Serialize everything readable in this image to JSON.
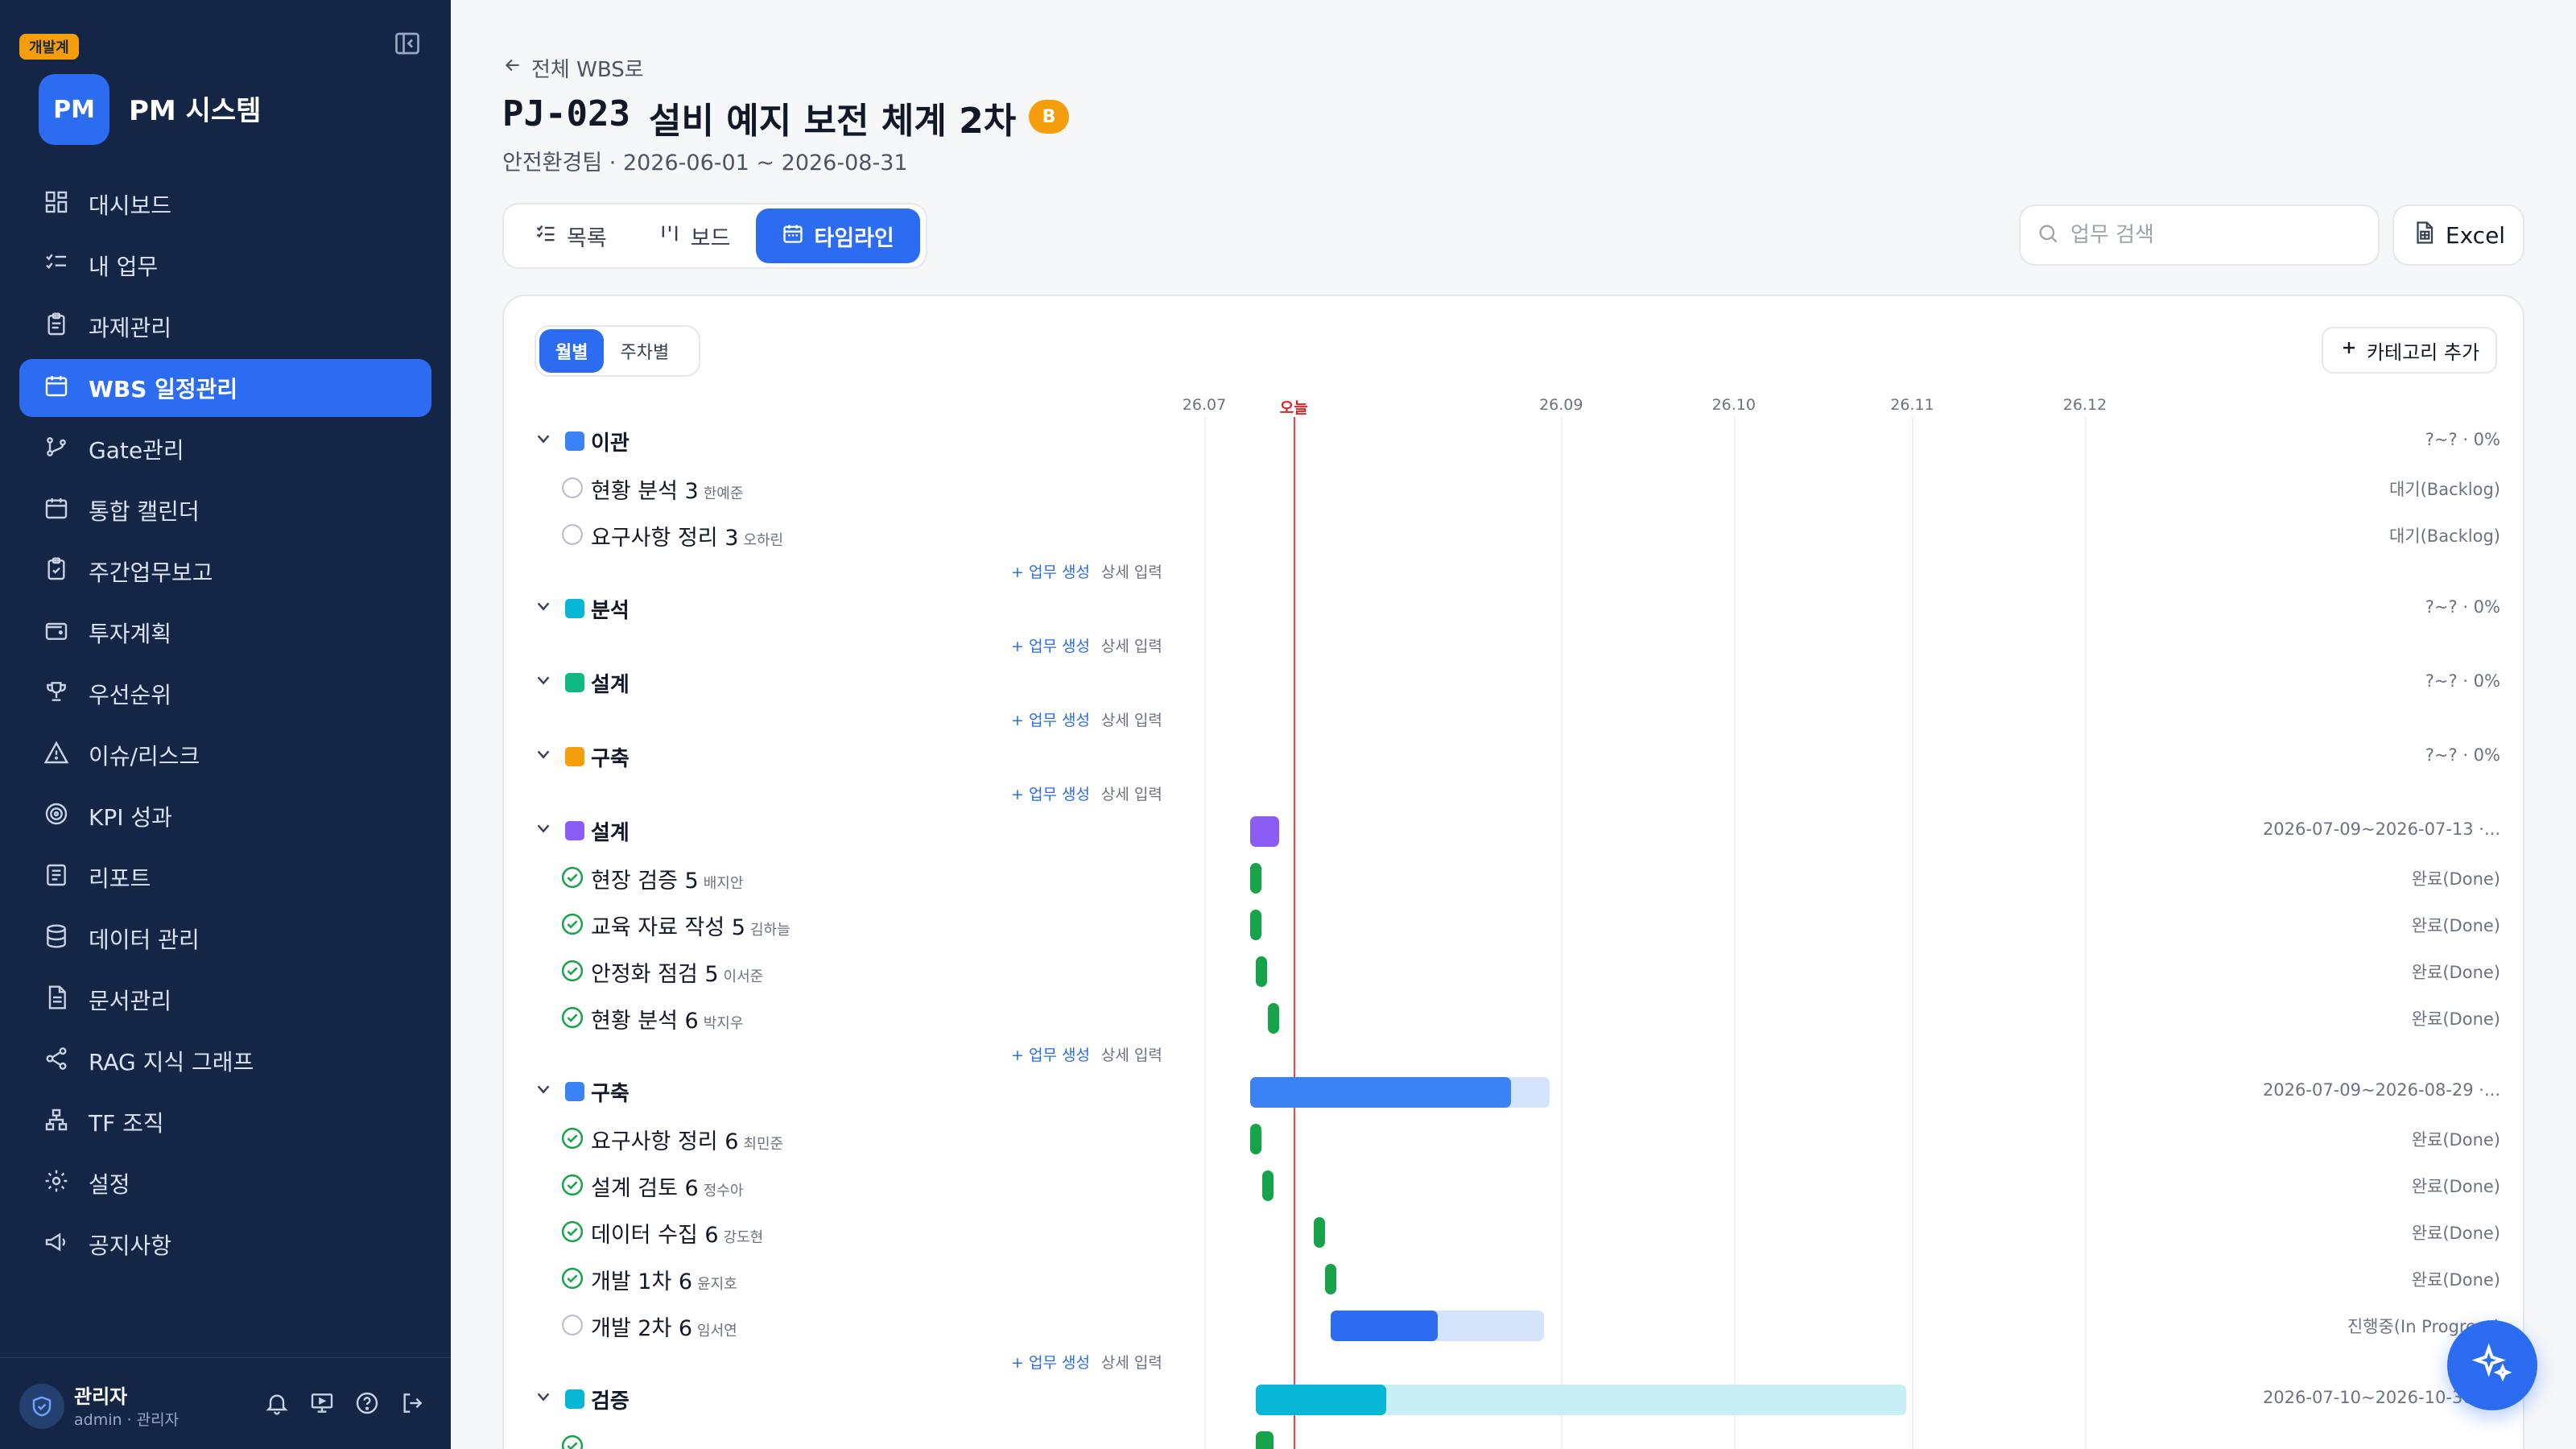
{
  "sidebar": {
    "env_badge": "개발계",
    "logo": "PM",
    "app_name": "PM 시스템",
    "items": [
      {
        "label": "대시보드",
        "icon": "dashboard-icon"
      },
      {
        "label": "내 업무",
        "icon": "checklist-icon"
      },
      {
        "label": "과제관리",
        "icon": "clipboard-icon"
      },
      {
        "label": "WBS 일정관리",
        "icon": "calendar-icon",
        "active": true
      },
      {
        "label": "Gate관리",
        "icon": "git-branch-icon"
      },
      {
        "label": "통합 캘린더",
        "icon": "calendar-icon"
      },
      {
        "label": "주간업무보고",
        "icon": "clipboard-check-icon"
      },
      {
        "label": "투자계획",
        "icon": "wallet-icon"
      },
      {
        "label": "우선순위",
        "icon": "trophy-icon"
      },
      {
        "label": "이슈/리스크",
        "icon": "warning-icon"
      },
      {
        "label": "KPI 성과",
        "icon": "target-icon"
      },
      {
        "label": "리포트",
        "icon": "report-icon"
      },
      {
        "label": "데이터 관리",
        "icon": "database-icon"
      },
      {
        "label": "문서관리",
        "icon": "document-icon"
      },
      {
        "label": "RAG 지식 그래프",
        "icon": "share-icon"
      },
      {
        "label": "TF 조직",
        "icon": "org-chart-icon"
      },
      {
        "label": "설정",
        "icon": "gear-icon"
      },
      {
        "label": "공지사항",
        "icon": "megaphone-icon"
      }
    ],
    "user": {
      "name": "관리자",
      "sub": "admin · 관리자"
    }
  },
  "header": {
    "back_label": "전체 WBS로",
    "project_code": "PJ-023",
    "project_name": "설비 예지 보전 체계 2차",
    "grade": "B",
    "subtitle": "안전환경팀 · 2026-06-01 ~ 2026-08-31"
  },
  "view_tabs": [
    {
      "label": "목록",
      "icon": "list-check-icon"
    },
    {
      "label": "보드",
      "icon": "kanban-icon"
    },
    {
      "label": "타임라인",
      "icon": "calendar-icon",
      "active": true
    }
  ],
  "search": {
    "placeholder": "업무 검색",
    "value": ""
  },
  "excel_label": "Excel",
  "scale_tabs": [
    {
      "label": "월별",
      "active": true
    },
    {
      "label": "주차별"
    }
  ],
  "add_category_label": "카테고리 추가",
  "row_actions": {
    "create": "+ 업무 생성",
    "detail": "상세 입력"
  },
  "timeline": {
    "labels": [
      "26.07",
      "오늘",
      "26.09",
      "26.10",
      "26.11",
      "26.12"
    ],
    "today_label": "오늘"
  },
  "colors": {
    "accent": "#2b6cf0",
    "done": "#16a34a",
    "today": "#ef4444"
  },
  "rows": [
    {
      "type": "category",
      "name": "이관",
      "color": "#3b82f6",
      "info": "?~? · 0%"
    },
    {
      "type": "task",
      "name": "현황 분석 3",
      "assignee": "한예준",
      "status": "todo",
      "info": "대기(Backlog)"
    },
    {
      "type": "task",
      "name": "요구사항 정리 3",
      "assignee": "오하린",
      "status": "todo",
      "info": "대기(Backlog)"
    },
    {
      "type": "actions"
    },
    {
      "type": "category",
      "name": "분석",
      "color": "#06b6d4",
      "info": "?~? · 0%"
    },
    {
      "type": "actions"
    },
    {
      "type": "category",
      "name": "설계",
      "color": "#10b981",
      "info": "?~? · 0%"
    },
    {
      "type": "actions"
    },
    {
      "type": "category",
      "name": "구축",
      "color": "#f59e0b",
      "info": "?~? · 0%"
    },
    {
      "type": "actions"
    },
    {
      "type": "category",
      "name": "설계",
      "color": "#8b5cf6",
      "info": "2026-07-09~2026-07-13 ·...",
      "start": "2026-07-09",
      "end": "2026-07-13",
      "progress": 1.0
    },
    {
      "type": "task",
      "name": "현장 검증 5",
      "assignee": "배지안",
      "status": "done",
      "info": "완료(Done)",
      "start": "2026-07-09",
      "end": "2026-07-10"
    },
    {
      "type": "task",
      "name": "교육 자료 작성 5",
      "assignee": "김하늘",
      "status": "done",
      "info": "완료(Done)",
      "start": "2026-07-09",
      "end": "2026-07-11"
    },
    {
      "type": "task",
      "name": "안정화 점검 5",
      "assignee": "이서준",
      "status": "done",
      "info": "완료(Done)",
      "start": "2026-07-10",
      "end": "2026-07-11"
    },
    {
      "type": "task",
      "name": "현황 분석 6",
      "assignee": "박지우",
      "status": "done",
      "info": "완료(Done)",
      "start": "2026-07-12",
      "end": "2026-07-13"
    },
    {
      "type": "actions"
    },
    {
      "type": "category",
      "name": "구축",
      "color": "#3b82f6",
      "info": "2026-07-09~2026-08-29 ·...",
      "start": "2026-07-09",
      "end": "2026-08-29",
      "progress": 0.87
    },
    {
      "type": "task",
      "name": "요구사항 정리 6",
      "assignee": "최민준",
      "status": "done",
      "info": "완료(Done)",
      "start": "2026-07-09",
      "end": "2026-07-11"
    },
    {
      "type": "task",
      "name": "설계 검토 6",
      "assignee": "정수아",
      "status": "done",
      "info": "완료(Done)",
      "start": "2026-07-11",
      "end": "2026-07-13"
    },
    {
      "type": "task",
      "name": "데이터 수집 6",
      "assignee": "강도현",
      "status": "done",
      "info": "완료(Done)",
      "start": "2026-07-20",
      "end": "2026-07-21"
    },
    {
      "type": "task",
      "name": "개발 1차 6",
      "assignee": "윤지호",
      "status": "done",
      "info": "완료(Done)",
      "start": "2026-07-22",
      "end": "2026-07-23"
    },
    {
      "type": "task",
      "name": "개발 2차 6",
      "assignee": "임서연",
      "status": "in_progress",
      "info": "진행중(In Progress)",
      "start": "2026-07-23",
      "end": "2026-08-29",
      "progress": 0.5
    },
    {
      "type": "actions"
    },
    {
      "type": "category",
      "name": "검증",
      "color": "#06b6d4",
      "info": "2026-07-10~2026-10-30 ·...",
      "start": "2026-07-10",
      "end": "2026-10-30",
      "progress": 0.2
    },
    {
      "type": "task",
      "name": "",
      "assignee": "",
      "status": "done",
      "info": "",
      "start": "2026-07-10",
      "end": "2026-07-13"
    }
  ]
}
